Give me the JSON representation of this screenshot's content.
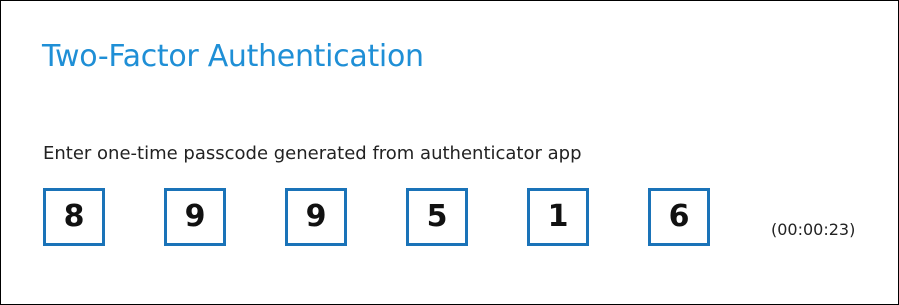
{
  "dialog": {
    "title": "Two-Factor Authentication",
    "instruction": "Enter one-time passcode generated from authenticator app",
    "passcode_digits": [
      "8",
      "9",
      "9",
      "5",
      "1",
      "6"
    ],
    "timer": "(00:00:23)"
  },
  "colors": {
    "title": "#1f8fd6",
    "box_border": "#1a73b8",
    "text": "#222222"
  }
}
